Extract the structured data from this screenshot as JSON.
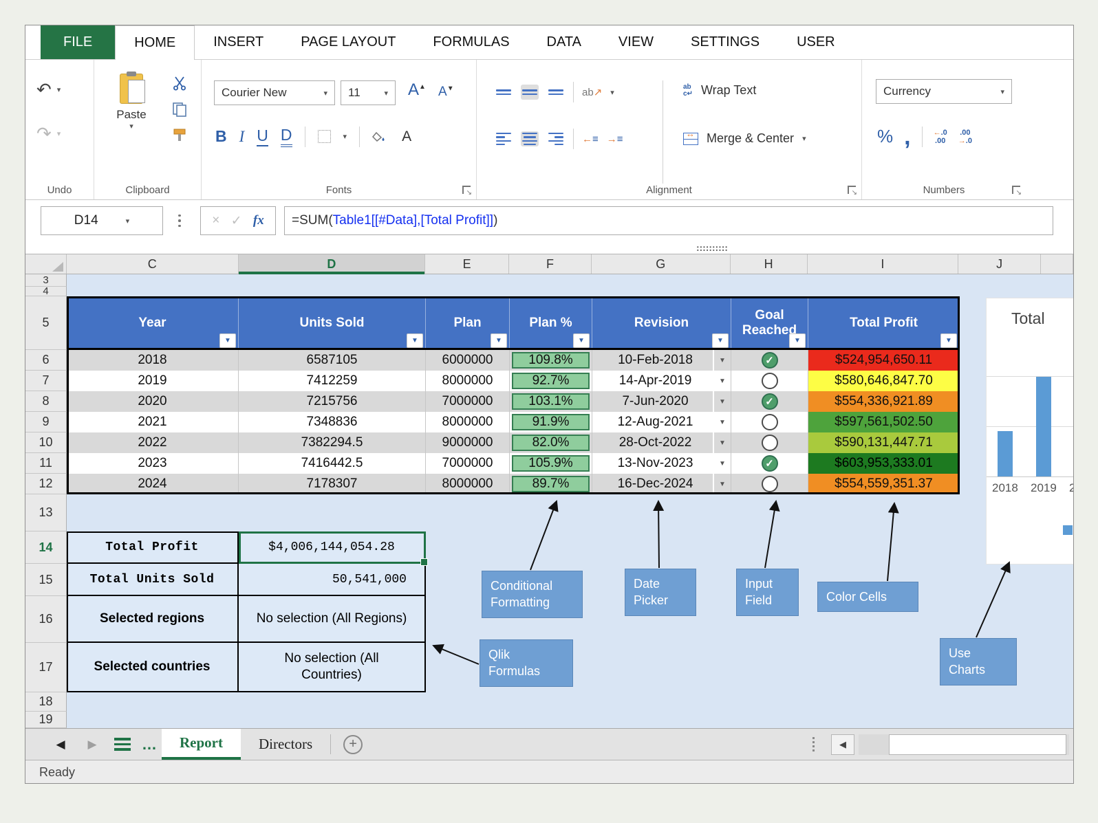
{
  "app": {
    "status_bar": "Ready"
  },
  "ribbon": {
    "tabs": [
      "FILE",
      "HOME",
      "INSERT",
      "PAGE LAYOUT",
      "FORMULAS",
      "DATA",
      "VIEW",
      "SETTINGS",
      "USER"
    ],
    "active_tab": "HOME",
    "undo": {
      "label": "Undo"
    },
    "clipboard": {
      "label": "Clipboard",
      "paste": "Paste"
    },
    "fonts": {
      "label": "Fonts",
      "font_name": "Courier New",
      "font_size": "11",
      "bold": "B",
      "italic": "I",
      "underline": "U",
      "double_underline": "D"
    },
    "alignment": {
      "label": "Alignment",
      "wrap_text": "Wrap Text",
      "merge_center": "Merge & Center"
    },
    "numbers": {
      "label": "Numbers",
      "format": "Currency",
      "percent": "%",
      "comma": ","
    }
  },
  "formula_bar": {
    "cell_ref": "D14",
    "fx_label": "fx",
    "formula": {
      "prefix": "=SUM(",
      "reference": "Table1[[#Data],[Total Profit]]",
      "suffix": ")"
    }
  },
  "grid": {
    "column_headers": [
      "C",
      "D",
      "E",
      "F",
      "G",
      "H",
      "I",
      "J"
    ],
    "selected_column": "D",
    "row_headers": [
      "3",
      "4",
      "5",
      "6",
      "7",
      "8",
      "9",
      "10",
      "11",
      "12",
      "13",
      "14",
      "15",
      "16",
      "17",
      "18",
      "19"
    ],
    "selected_row": "14"
  },
  "table": {
    "headers": [
      "Year",
      "Units Sold",
      "Plan",
      "Plan %",
      "Revision",
      "Goal",
      "Reached",
      "Total Profit"
    ],
    "rows": [
      {
        "year": "2018",
        "units_sold": "6587105",
        "plan": "6000000",
        "plan_pct": "109.8%",
        "revision": "10-Feb-2018",
        "goal_reached": true,
        "total_profit": "$524,954,650.11",
        "profit_color": "#ea2a1c"
      },
      {
        "year": "2019",
        "units_sold": "7412259",
        "plan": "8000000",
        "plan_pct": "92.7%",
        "revision": "14-Apr-2019",
        "goal_reached": false,
        "total_profit": "$580,646,847.70",
        "profit_color": "#fdfd45"
      },
      {
        "year": "2020",
        "units_sold": "7215756",
        "plan": "7000000",
        "plan_pct": "103.1%",
        "revision": "7-Jun-2020",
        "goal_reached": true,
        "total_profit": "$554,336,921.89",
        "profit_color": "#f08e23"
      },
      {
        "year": "2021",
        "units_sold": "7348836",
        "plan": "8000000",
        "plan_pct": "91.9%",
        "revision": "12-Aug-2021",
        "goal_reached": false,
        "total_profit": "$597,561,502.50",
        "profit_color": "#4ea33c"
      },
      {
        "year": "2022",
        "units_sold": "7382294.5",
        "plan": "9000000",
        "plan_pct": "82.0%",
        "revision": "28-Oct-2022",
        "goal_reached": false,
        "total_profit": "$590,131,447.71",
        "profit_color": "#a9ca3d"
      },
      {
        "year": "2023",
        "units_sold": "7416442.5",
        "plan": "7000000",
        "plan_pct": "105.9%",
        "revision": "13-Nov-2023",
        "goal_reached": true,
        "total_profit": "$603,953,333.01",
        "profit_color": "#1d7a20"
      },
      {
        "year": "2024",
        "units_sold": "7178307",
        "plan": "8000000",
        "plan_pct": "89.7%",
        "revision": "16-Dec-2024",
        "goal_reached": false,
        "total_profit": "$554,559,351.37",
        "profit_color": "#f08e23"
      }
    ]
  },
  "summary": {
    "rows": [
      {
        "label": "Total Profit",
        "value": "$4,006,144,054.28"
      },
      {
        "label": "Total Units Sold",
        "value": "50,541,000"
      },
      {
        "label": "Selected regions",
        "value": "No selection (All Regions)"
      },
      {
        "label": "Selected countries",
        "value": "No selection (All Countries)"
      }
    ]
  },
  "chart_data": {
    "type": "bar",
    "title": "Total",
    "categories_visible": [
      "2018",
      "2019",
      "2"
    ],
    "bars_rel_height": [
      0.45,
      1.0
    ],
    "bar_color": "#5b9bd5",
    "note_layout": {
      "grid": "on",
      "clipped_right": true
    }
  },
  "callouts": {
    "conditional_formatting": "Conditional Formatting",
    "date_picker": "Date Picker",
    "input_field": "Input Field",
    "color_cells": "Color Cells",
    "qlik_formulas": "Qlik Formulas",
    "use_charts": "Use Charts"
  },
  "sheet_bar": {
    "tabs": [
      {
        "label": "Report",
        "active": true
      },
      {
        "label": "Directors",
        "active": false
      }
    ]
  },
  "colors": {
    "accent_green": "#1f7346",
    "header_blue": "#4472c4",
    "plan_green": "#8fcd9d",
    "callout_blue": "#6f9fd3"
  }
}
